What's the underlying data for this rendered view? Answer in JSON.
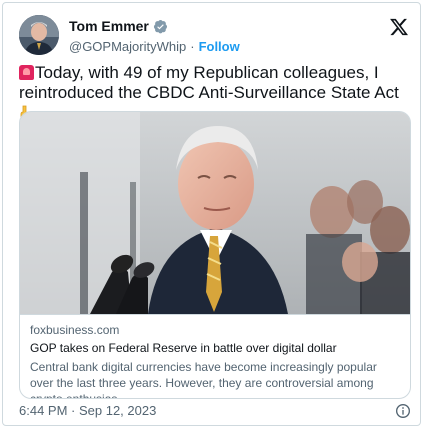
{
  "author": {
    "display_name": "Tom Emmer",
    "handle": "@GOPMajorityWhip",
    "separator": "·",
    "follow_label": "Follow",
    "verified_icon": "verified-badge-icon"
  },
  "tweet": {
    "text_main": "Today, with 49 of my Republican colleagues, I reintroduced the CBDC Anti-Surveillance State Act",
    "leading_emoji": "siren-emoji",
    "trailing_emoji": "pointing-down-emoji"
  },
  "link_card": {
    "domain": "foxbusiness.com",
    "headline": "GOP takes on Federal Reserve in battle over digital dollar",
    "description": "Central bank digital currencies have become increasingly popular over the last three years. However, they are controversial among crypto enthusias..."
  },
  "footer": {
    "timestamp": "6:44 PM · Sep 12, 2023"
  },
  "colors": {
    "accent": "#1d9bf0",
    "muted": "#536471",
    "text": "#0f1419",
    "border": "#cfd9de"
  }
}
